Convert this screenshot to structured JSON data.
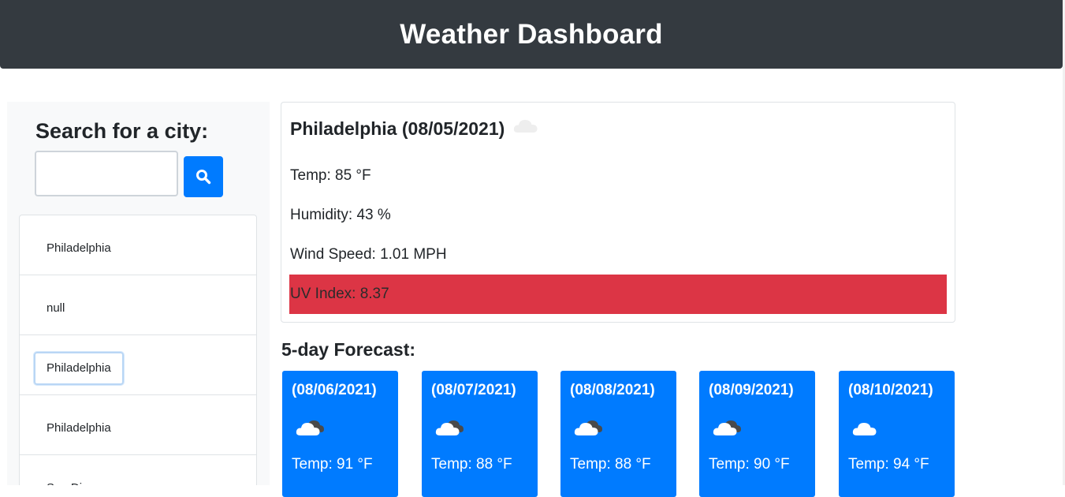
{
  "header": {
    "title": "Weather Dashboard"
  },
  "search": {
    "title": "Search for a city:",
    "input_value": "",
    "input_placeholder": "",
    "button_icon": "search-icon"
  },
  "history": {
    "items": [
      {
        "label": "Philadelphia"
      },
      {
        "label": "null"
      },
      {
        "label": "Philadelphia"
      },
      {
        "label": "Philadelphia"
      },
      {
        "label": "San Diego"
      }
    ],
    "focused_index": 2
  },
  "current": {
    "title": "Philadelphia (08/05/2021)",
    "icon": "cloud-icon",
    "temp": "Temp: 85 °F",
    "humidity": "Humidity: 43 %",
    "wind": "Wind Speed: 1.01 MPH",
    "uv": "UV Index: 8.37",
    "uv_color": "#dc3545"
  },
  "forecast": {
    "title": "5-day Forecast:",
    "card_color": "#007bff",
    "days": [
      {
        "date": "(08/06/2021)",
        "icon": "broken-clouds-icon",
        "temp": "Temp: 91 °F"
      },
      {
        "date": "(08/07/2021)",
        "icon": "broken-clouds-icon",
        "temp": "Temp: 88 °F"
      },
      {
        "date": "(08/08/2021)",
        "icon": "broken-clouds-icon",
        "temp": "Temp: 88 °F"
      },
      {
        "date": "(08/09/2021)",
        "icon": "broken-clouds-icon",
        "temp": "Temp: 90 °F"
      },
      {
        "date": "(08/10/2021)",
        "icon": "cloud-icon",
        "temp": "Temp: 94 °F"
      }
    ]
  }
}
